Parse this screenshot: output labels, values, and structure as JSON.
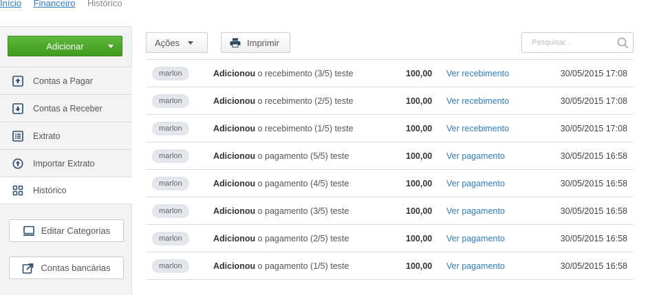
{
  "breadcrumb": {
    "home": "Início",
    "financeiro": "Financeiro",
    "current": "Histórico"
  },
  "sidebar": {
    "add_label": "Adicionar",
    "items": [
      {
        "label": "Contas a Pagar",
        "icon": "upload-icon"
      },
      {
        "label": "Contas a Receber",
        "icon": "download-icon"
      },
      {
        "label": "Extrato",
        "icon": "list-icon"
      },
      {
        "label": "Importar Extrato",
        "icon": "import-icon"
      },
      {
        "label": "Histórico",
        "icon": "grid-icon"
      }
    ],
    "edit_categories": "Editar Categorias",
    "bank_accounts": "Contas bancárias"
  },
  "toolbar": {
    "actions_label": "Ações",
    "print_label": "Imprimir",
    "search_placeholder": "Pesquisar..."
  },
  "rows": [
    {
      "user": "marlon",
      "verb": "Adicionou",
      "desc": "o recebimento (3/5) teste",
      "amount": "100,00",
      "link": "Ver recebimento",
      "date": "30/05/2015 17:08"
    },
    {
      "user": "marlon",
      "verb": "Adicionou",
      "desc": "o recebimento (2/5) teste",
      "amount": "100,00",
      "link": "Ver recebimento",
      "date": "30/05/2015 17:08"
    },
    {
      "user": "marlon",
      "verb": "Adicionou",
      "desc": "o recebimento (1/5) teste",
      "amount": "100,00",
      "link": "Ver recebimento",
      "date": "30/05/2015 17:08"
    },
    {
      "user": "marlon",
      "verb": "Adicionou",
      "desc": "o pagamento (5/5) teste",
      "amount": "100,00",
      "link": "Ver pagamento",
      "date": "30/05/2015 16:58"
    },
    {
      "user": "marlon",
      "verb": "Adicionou",
      "desc": "o pagamento (4/5) teste",
      "amount": "100,00",
      "link": "Ver pagamento",
      "date": "30/05/2015 16:58"
    },
    {
      "user": "marlon",
      "verb": "Adicionou",
      "desc": "o pagamento (3/5) teste",
      "amount": "100,00",
      "link": "Ver pagamento",
      "date": "30/05/2015 16:58"
    },
    {
      "user": "marlon",
      "verb": "Adicionou",
      "desc": "o pagamento (2/5) teste",
      "amount": "100,00",
      "link": "Ver pagamento",
      "date": "30/05/2015 16:58"
    },
    {
      "user": "marlon",
      "verb": "Adicionou",
      "desc": "o pagamento (1/5) teste",
      "amount": "100,00",
      "link": "Ver pagamento",
      "date": "30/05/2015 16:58"
    }
  ],
  "colors": {
    "accent": "#4aa82a",
    "link": "#2e7dbf"
  }
}
